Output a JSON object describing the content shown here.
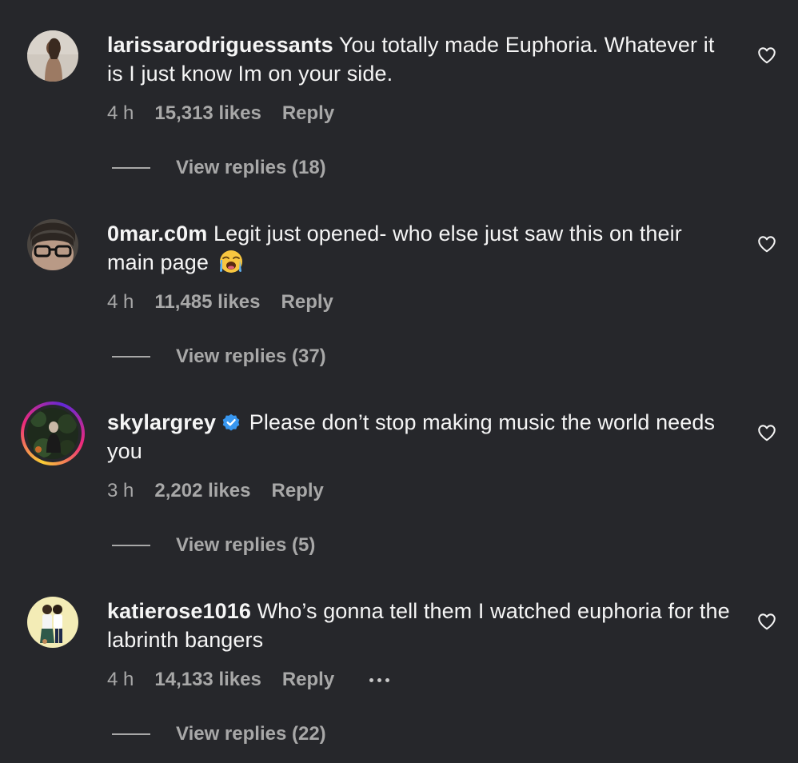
{
  "comments": [
    {
      "username": "larissarodriguessants",
      "text": "You totally made Euphoria. Whatever it is I just know Im on your side.",
      "time": "4 h",
      "likes": "15,313 likes",
      "reply": "Reply",
      "view_replies": "View replies (18)"
    },
    {
      "username": "0mar.c0m",
      "text": "Legit just opened- who else just saw this on their main page",
      "emoji": "loudly-crying-face-emoji",
      "time": "4 h",
      "likes": "11,485 likes",
      "reply": "Reply",
      "view_replies": "View replies (37)"
    },
    {
      "username": "skylargrey",
      "verified": true,
      "text": "Please don’t stop making music the world needs you",
      "time": "3 h",
      "likes": "2,202 likes",
      "reply": "Reply",
      "view_replies": "View replies (5)"
    },
    {
      "username": "katierose1016",
      "text": "Who’s gonna tell them I watched euphoria for the labrinth bangers",
      "time": "4 h",
      "likes": "14,133 likes",
      "reply": "Reply",
      "more": "more-options-icon",
      "view_replies": "View replies (22)"
    }
  ],
  "colors": {
    "background": "#26272b",
    "primary_text": "#f5f5f5",
    "secondary_text": "#a8a8a8",
    "verified_blue": "#3897f0"
  }
}
